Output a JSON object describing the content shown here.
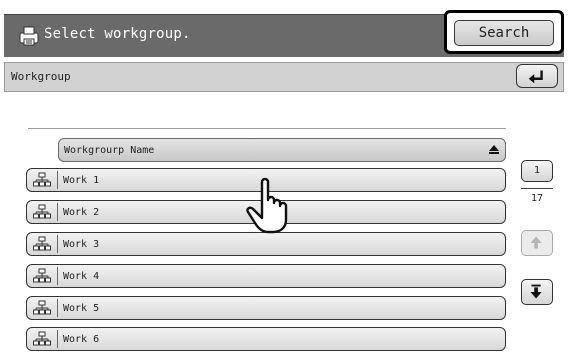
{
  "header": {
    "title": "Select workgroup.",
    "search_label": "Search"
  },
  "workgroup_bar": {
    "label": "Workgroup"
  },
  "list": {
    "column_header": "Workgrourp Name",
    "rows": [
      {
        "label": "Work 1"
      },
      {
        "label": "Work 2"
      },
      {
        "label": "Work 3"
      },
      {
        "label": "Work 4"
      },
      {
        "label": "Work 5"
      },
      {
        "label": "Work 6"
      }
    ]
  },
  "pager": {
    "current_page": "1",
    "total_pages": "17"
  },
  "colors": {
    "header_bg": "#6a6a6a",
    "bar_bg": "#d2d2d2",
    "button_border": "#333333"
  },
  "icons": {
    "header": "printer-icon",
    "row": "network-group-icon",
    "back": "return-arrow-icon",
    "sort": "sort-ascending-icon",
    "up": "arrow-up-icon",
    "down": "arrow-down-icon",
    "cursor": "hand-pointer-icon"
  }
}
